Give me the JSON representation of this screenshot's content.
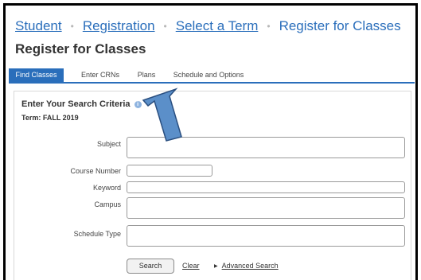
{
  "breadcrumb": {
    "items": [
      {
        "label": "Student",
        "link": true
      },
      {
        "label": "Registration",
        "link": true
      },
      {
        "label": "Select a Term",
        "link": true
      },
      {
        "label": "Register for Classes",
        "link": false
      }
    ],
    "separator": "•"
  },
  "page_title": "Register for Classes",
  "tabs": [
    {
      "label": "Find Classes",
      "active": true
    },
    {
      "label": "Enter CRNs",
      "active": false
    },
    {
      "label": "Plans",
      "active": false
    },
    {
      "label": "Schedule and Options",
      "active": false
    }
  ],
  "search": {
    "heading": "Enter Your Search Criteria",
    "info_icon": "info-icon",
    "term_text": "Term: FALL 2019",
    "fields": {
      "subject": {
        "label": "Subject",
        "value": ""
      },
      "course_number": {
        "label": "Course Number",
        "value": ""
      },
      "keyword": {
        "label": "Keyword",
        "value": ""
      },
      "campus": {
        "label": "Campus",
        "value": ""
      },
      "schedule_type": {
        "label": "Schedule Type",
        "value": ""
      }
    },
    "search_button": "Search",
    "clear_link": "Clear",
    "advanced_search": "Advanced Search",
    "advanced_caret": "▶"
  },
  "annotation": {
    "shape": "arrow",
    "color": "#5b8fc9",
    "outline": "#2a4f80",
    "points_to": "Plans tab"
  },
  "colors": {
    "accent": "#2a6ebb",
    "text": "#333333"
  }
}
